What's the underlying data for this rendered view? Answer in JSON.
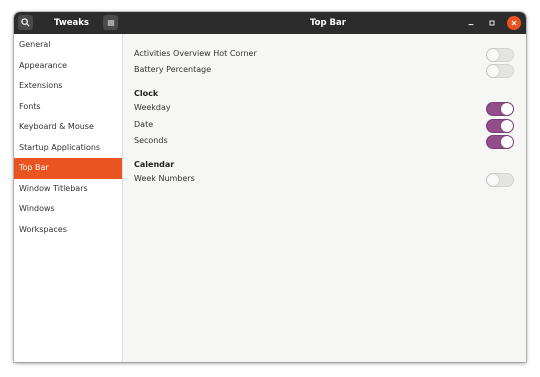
{
  "header": {
    "app_title": "Tweaks",
    "page_title": "Top Bar",
    "search_icon": "search-icon",
    "menu_icon": "hamburger-menu-icon"
  },
  "sidebar": {
    "items": [
      {
        "label": "General"
      },
      {
        "label": "Appearance"
      },
      {
        "label": "Extensions"
      },
      {
        "label": "Fonts"
      },
      {
        "label": "Keyboard & Mouse"
      },
      {
        "label": "Startup Applications"
      },
      {
        "label": "Top Bar",
        "selected": true
      },
      {
        "label": "Window Titlebars"
      },
      {
        "label": "Windows"
      },
      {
        "label": "Workspaces"
      }
    ]
  },
  "settings": {
    "hot_corner": {
      "label": "Activities Overview Hot Corner",
      "enabled": false
    },
    "battery": {
      "label": "Battery Percentage",
      "enabled": false
    },
    "clock": {
      "heading": "Clock",
      "weekday": {
        "label": "Weekday",
        "enabled": true
      },
      "date": {
        "label": "Date",
        "enabled": true
      },
      "seconds": {
        "label": "Seconds",
        "enabled": true
      }
    },
    "calendar": {
      "heading": "Calendar",
      "week_numbers": {
        "label": "Week Numbers",
        "enabled": false
      }
    }
  },
  "colors": {
    "accent": "#e95420",
    "toggle_on": "#924d8b",
    "headerbar": "#2c2c2c"
  }
}
